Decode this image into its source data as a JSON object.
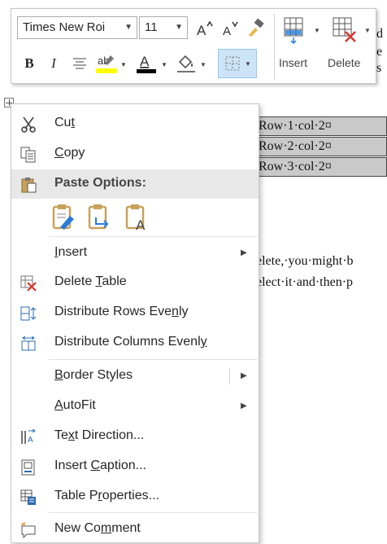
{
  "toolbar": {
    "font_name": "Times New Roi",
    "font_size": "11",
    "insert_label": "Insert",
    "delete_label": "Delete",
    "highlight_color": "#ffff00",
    "font_color": "#000000"
  },
  "document": {
    "cells": [
      "Row·1·col·2¤",
      "Row·2·col·2¤",
      "Row·3·col·2¤"
    ],
    "frag_right_1": "d",
    "frag_right_2": "e",
    "frag_right_3": "s",
    "line_1": "elete,·you·might·b",
    "line_2": "elect·it·and·then·p"
  },
  "menu": {
    "items": [
      {
        "id": "cut",
        "pre": "Cu",
        "ul": "t",
        "post": "",
        "icon": "scissors-icon"
      },
      {
        "id": "copy",
        "pre": "",
        "ul": "C",
        "post": "opy",
        "icon": "copy-icon"
      },
      {
        "id": "paste_options",
        "pre": "Paste Options:",
        "ul": "",
        "post": "",
        "icon": "paste-icon"
      },
      {
        "id": "insert",
        "pre": "",
        "ul": "I",
        "post": "nsert",
        "icon": "",
        "submenu": true
      },
      {
        "id": "delete_table",
        "pre": "Delete ",
        "ul": "T",
        "post": "able",
        "icon": "delete-table-icon"
      },
      {
        "id": "distribute_rows",
        "pre": "Distribute Rows Eve",
        "ul": "n",
        "post": "ly",
        "icon": "distribute-rows-icon"
      },
      {
        "id": "distribute_columns",
        "pre": "Distribute Columns Evenl",
        "ul": "y",
        "post": "",
        "icon": "distribute-columns-icon"
      },
      {
        "id": "border_styles",
        "pre": "",
        "ul": "B",
        "post": "order Styles",
        "icon": "",
        "submenu": true
      },
      {
        "id": "autofit",
        "pre": "",
        "ul": "A",
        "post": "utoFit",
        "icon": "",
        "submenu": true
      },
      {
        "id": "text_direction",
        "pre": "Te",
        "ul": "x",
        "post": "t Direction...",
        "icon": "text-direction-icon"
      },
      {
        "id": "insert_caption",
        "pre": "Insert ",
        "ul": "C",
        "post": "aption...",
        "icon": "insert-caption-icon"
      },
      {
        "id": "table_properties",
        "pre": "Table P",
        "ul": "r",
        "post": "operties...",
        "icon": "table-properties-icon"
      },
      {
        "id": "new_comment",
        "pre": "New Co",
        "ul": "m",
        "post": "ment",
        "icon": "new-comment-icon"
      }
    ]
  }
}
